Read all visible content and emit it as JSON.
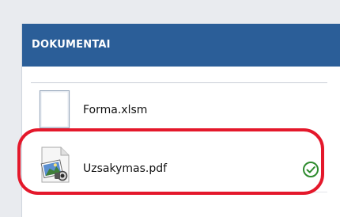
{
  "panel": {
    "title": "DOKUMENTAI"
  },
  "documents": [
    {
      "name": "Forma.xlsm",
      "icon": "blank-file-icon",
      "status": null
    },
    {
      "name": "Uzsakymas.pdf",
      "icon": "pdf-file-icon",
      "status": "check-circle-icon"
    }
  ],
  "colors": {
    "header_bg": "#2b5e98",
    "highlight": "#e4182b",
    "check": "#2e8b2e",
    "background": "#e9ebef"
  }
}
